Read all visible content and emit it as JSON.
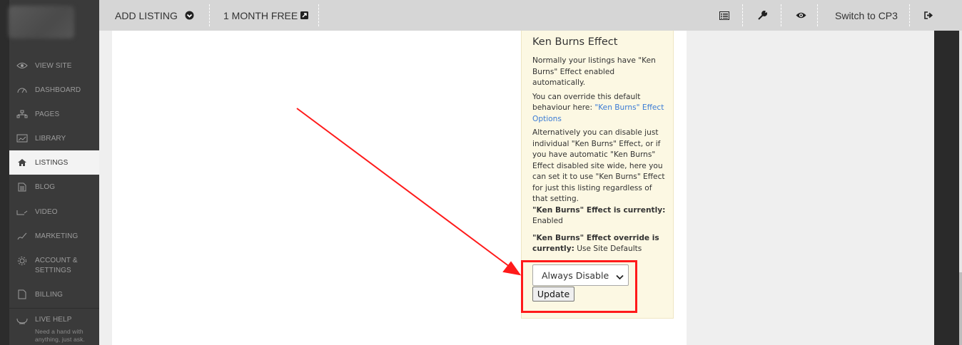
{
  "sidebar": {
    "items": [
      {
        "label": "VIEW SITE",
        "icon": "eye-icon"
      },
      {
        "label": "DASHBOARD",
        "icon": "gauge-icon"
      },
      {
        "label": "PAGES",
        "icon": "sitemap-icon"
      },
      {
        "label": "LIBRARY",
        "icon": "photo-library-icon"
      },
      {
        "label": "LISTINGS",
        "icon": "home-icon"
      },
      {
        "label": "BLOG",
        "icon": "document-icon"
      },
      {
        "label": "VIDEO",
        "icon": "video-icon"
      },
      {
        "label": "MARKETING",
        "icon": "chart-icon"
      },
      {
        "label_line1": "ACCOUNT &",
        "label_line2": "SETTINGS",
        "icon": "gear-icon"
      },
      {
        "label": "BILLING",
        "icon": "invoice-icon"
      },
      {
        "label": "LIVE HELP",
        "sub_line1": "Need a hand with",
        "sub_line2": "anything, just ask.",
        "icon": "chat-icon"
      }
    ],
    "active": "LISTINGS"
  },
  "topbar": {
    "add_listing": "ADD LISTING",
    "month_free": "1 MONTH FREE",
    "switch_cp3": "Switch to CP3",
    "icons": [
      "list-icon",
      "wrench-icon",
      "eye-icon",
      "sign-out-icon"
    ]
  },
  "ken_burns": {
    "title": "Ken Burns Effect",
    "p1": "Normally your listings have \"Ken Burns\" Effect enabled automatically.",
    "p2_text": "You can override this default behaviour here: ",
    "p2_link": "\"Ken Burns\" Effect Options",
    "p3": "Alternatively you can disable just individual \"Ken Burns\" Effect, or if you have automatic \"Ken Burns\" Effect disabled site wide, here you can set it to use \"Ken Burns\" Effect for just this listing regardless of that setting.",
    "status_label": "\"Ken Burns\" Effect is currently:",
    "status_value": "Enabled",
    "override_label": "\"Ken Burns\" Effect override is currently:",
    "override_value": "Use Site Defaults",
    "select_value": "Always Disable",
    "update_label": "Update"
  },
  "colors": {
    "annotation_red": "#ff1a1a",
    "sidebar_bg": "#3a3a3a",
    "topbar_bg": "#d6d6d6",
    "notice_bg": "#fcf8e3",
    "link_blue": "#3a7bd5"
  }
}
